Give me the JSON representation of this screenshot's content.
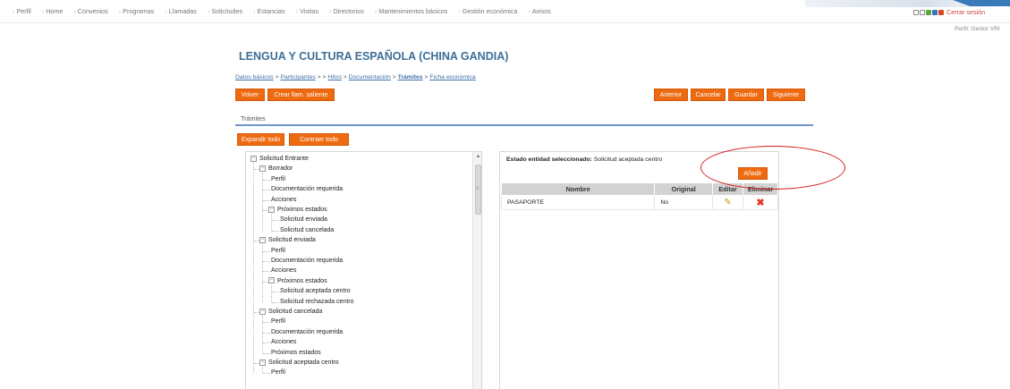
{
  "menu": [
    "Perfil",
    "Home",
    "Convenios",
    "Programas",
    "Llamadas",
    "Solicitudes",
    "Estancias",
    "Visitas",
    "Directorios",
    "Mantenimientos básicos",
    "Gestión económica",
    "Avisos"
  ],
  "logout_label": "Cerrar sesión",
  "profile_label": "Perfil: Gestor VRI",
  "page_title": "LENGUA Y CULTURA ESPAÑOLA (CHINA GANDIA)",
  "breadcrumb": {
    "datos_basicos": "Datos básicos",
    "sep1": " > ",
    "participantes": "Participantes",
    "sep2": " > > ",
    "hitos": "Hitos",
    "sep3": " > ",
    "documentacion": "Documentación",
    "sep4": " > ",
    "tramites": "Trámites",
    "sep5": " > ",
    "ficha_economica": "Ficha económica"
  },
  "buttons": {
    "volver": "Volver",
    "crear_llam": "Crear llam. saliente",
    "anterior": "Anterior",
    "cancelar": "Cancelar",
    "guardar": "Guardar",
    "siguiente": "Siguiente",
    "expandir": "Expandir todo",
    "contraer": "Contraer todo",
    "anadir": "Añadir"
  },
  "tab_label": "Trámites",
  "tree": [
    {
      "label": "Solicitud Entrante",
      "level": 0,
      "toggle": "−"
    },
    {
      "label": "Borrador",
      "level": 1,
      "toggle": "−"
    },
    {
      "label": "Perfil",
      "level": 2
    },
    {
      "label": "Documentación requerida",
      "level": 2
    },
    {
      "label": "Acciones",
      "level": 2
    },
    {
      "label": "Próximos estados",
      "level": 2,
      "toggle": "−"
    },
    {
      "label": "Solicitud enviada",
      "level": 3
    },
    {
      "label": "Solicitud cancelada",
      "level": 3
    },
    {
      "label": "Solicitud enviada",
      "level": 1,
      "toggle": "−"
    },
    {
      "label": "Perfil",
      "level": 2
    },
    {
      "label": "Documentación requerida",
      "level": 2
    },
    {
      "label": "Acciones",
      "level": 2
    },
    {
      "label": "Próximos estados",
      "level": 2,
      "toggle": "−"
    },
    {
      "label": "Solicitud aceptada centro",
      "level": 3
    },
    {
      "label": "Solicitud rechazada centro",
      "level": 3
    },
    {
      "label": "Solicitud cancelada",
      "level": 1,
      "toggle": "−"
    },
    {
      "label": "Perfil",
      "level": 2
    },
    {
      "label": "Documentación requerida",
      "level": 2
    },
    {
      "label": "Acciones",
      "level": 2
    },
    {
      "label": "Próximos estados",
      "level": 2
    },
    {
      "label": "Solicitud aceptada centro",
      "level": 1,
      "toggle": "−"
    },
    {
      "label": "Perfil",
      "level": 2
    }
  ],
  "selected_state": {
    "label": "Estado entidad seleccionado:",
    "value": "Solicitud aceptada centro"
  },
  "table": {
    "headers": [
      "Nombre",
      "Original",
      "Editar",
      "Eliminar"
    ],
    "rows": [
      {
        "nombre": "PASAPORTE",
        "original": "No"
      }
    ]
  },
  "icons": {
    "edit": "pencil-icon",
    "delete": "cross-icon"
  },
  "colors": {
    "accent_orange": "#ee6a10",
    "title_blue": "#3c6f98",
    "annotation_red": "#d51c1c"
  }
}
